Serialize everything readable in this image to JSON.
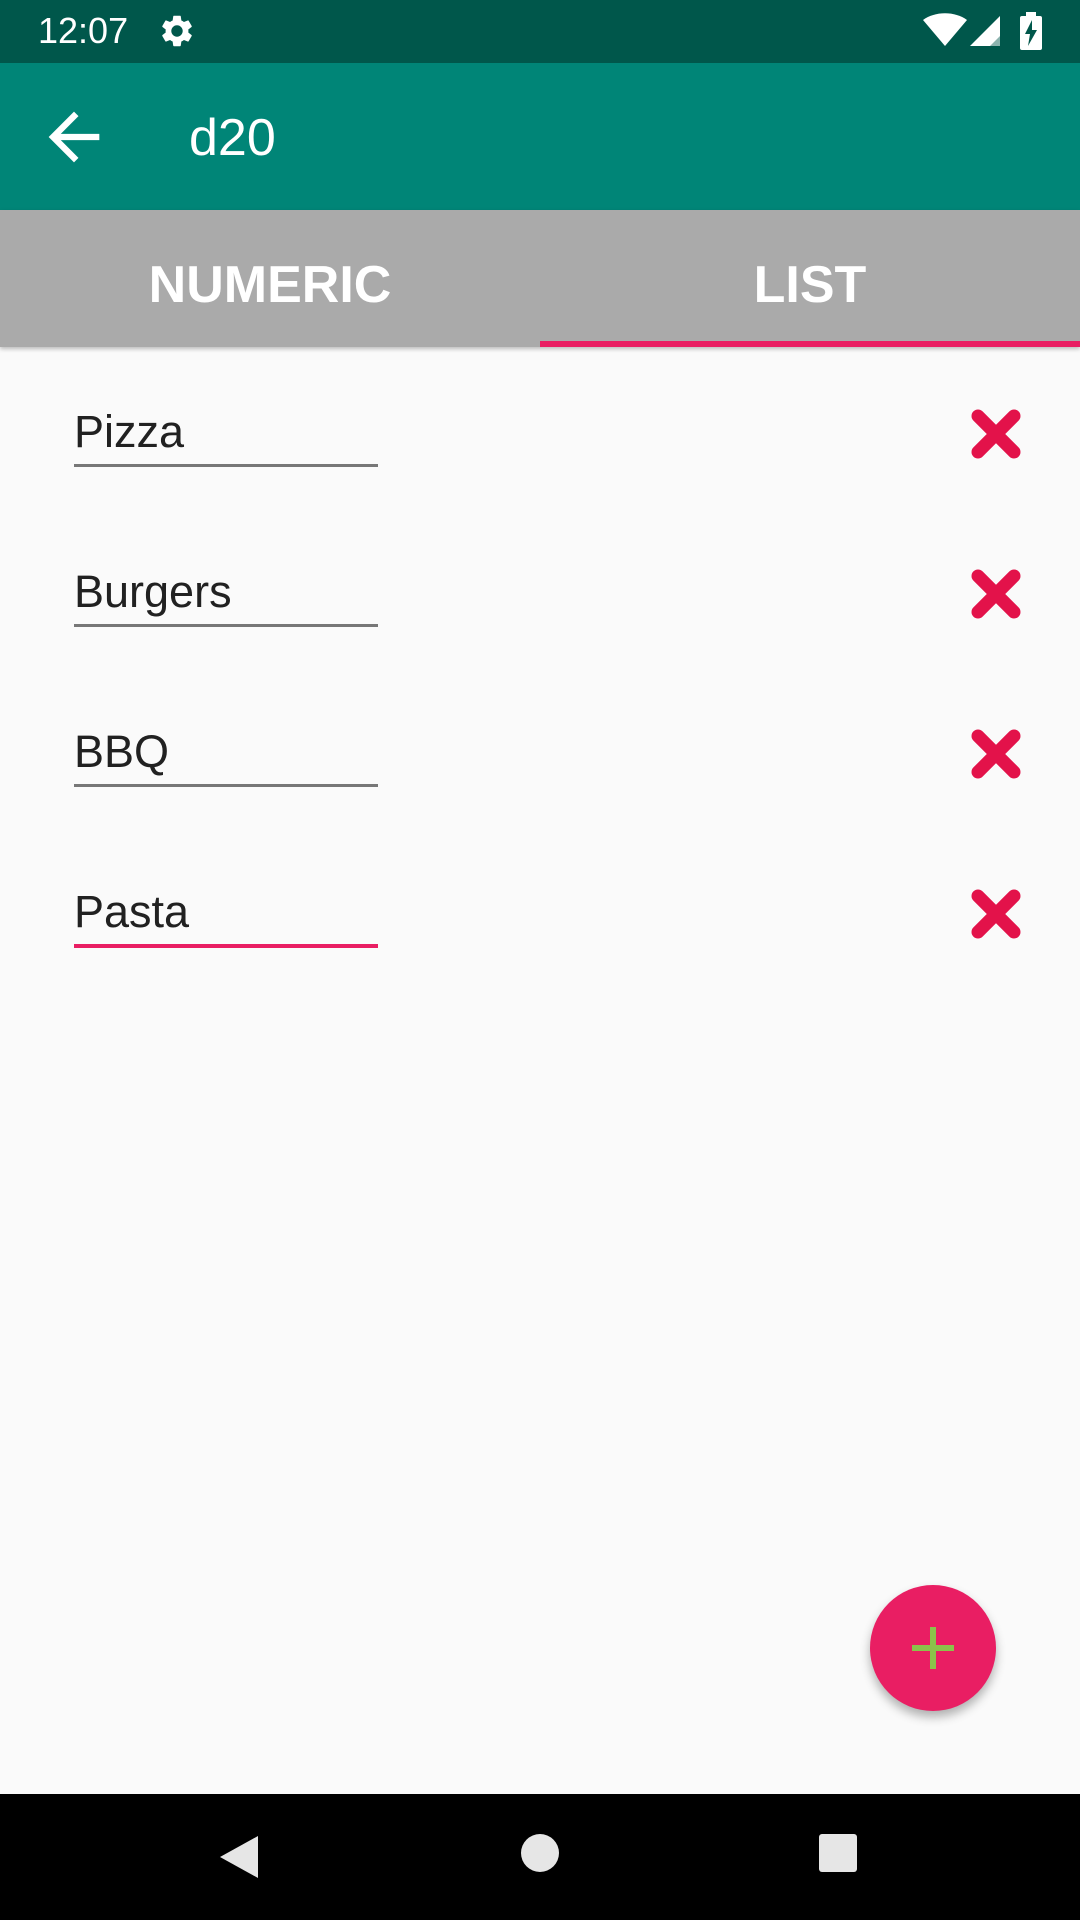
{
  "status_bar": {
    "time": "12:07",
    "icons": [
      "gear-icon",
      "wifi-icon",
      "signal-icon",
      "battery-icon"
    ],
    "background": "#00574b"
  },
  "app_bar": {
    "title": "d20",
    "back_icon": "arrow-back-icon",
    "background": "#008577"
  },
  "tabs": {
    "items": [
      {
        "label": "NUMERIC",
        "selected": false
      },
      {
        "label": "LIST",
        "selected": true
      }
    ],
    "background": "#aaaaaa",
    "indicator_color": "#e91e63"
  },
  "list": {
    "items": [
      {
        "value": "Pizza",
        "focused": false,
        "remove_icon": "close-icon"
      },
      {
        "value": "Burgers",
        "focused": false,
        "remove_icon": "close-icon"
      },
      {
        "value": "BBQ",
        "focused": false,
        "remove_icon": "close-icon"
      },
      {
        "value": "Pasta",
        "focused": true,
        "remove_icon": "close-icon"
      }
    ],
    "remove_icon_color": "#e3124a"
  },
  "fab": {
    "icon": "plus-icon",
    "background": "#e91e63",
    "icon_color": "#8bc34a"
  },
  "nav_bar": {
    "icons": [
      "nav-back-icon",
      "nav-home-icon",
      "nav-recents-icon"
    ]
  }
}
